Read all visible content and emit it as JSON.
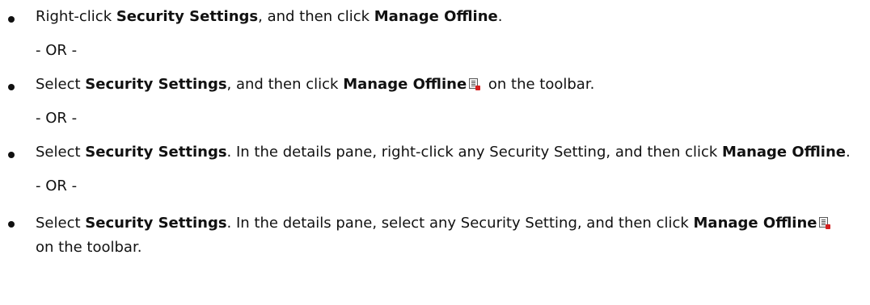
{
  "steps": [
    {
      "t1": "Right-click ",
      "b1": "Security Settings",
      "t2": ", and then click ",
      "b2": "Manage Offline",
      "t3": "."
    },
    {
      "t1": "Select ",
      "b1": "Security Settings",
      "t2": ", and then click ",
      "b2": "Manage Offline",
      "t3": " on the toolbar."
    },
    {
      "t1": "Select ",
      "b1": "Security Settings",
      "t2": ". In the details pane, right-click any Security Setting, and then click ",
      "b2": "Manage Offline",
      "t3": "."
    },
    {
      "t1": "Select ",
      "b1": "Security Settings",
      "t2": ". In the details pane, select any Security Setting, and then click ",
      "b2": "Manage Offline",
      "t3": " on the toolbar."
    }
  ],
  "separator": "- OR -",
  "icon": "manage-offline-icon",
  "colors": {
    "text": "#111111",
    "icon_accent": "#d42020"
  }
}
